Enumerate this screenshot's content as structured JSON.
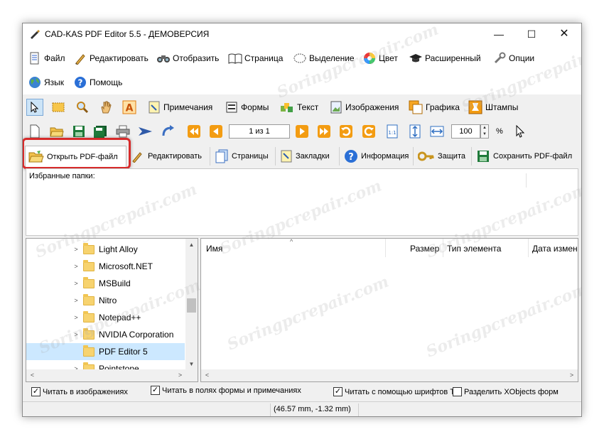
{
  "window": {
    "title": "CAD-KAS PDF Editor 5.5 - ДЕМОВЕРСИЯ",
    "controls": {
      "minimize": "—",
      "maximize": "☐",
      "close": "✕"
    }
  },
  "menu": {
    "items": [
      {
        "label": "Файл",
        "icon": "file-icon"
      },
      {
        "label": "Редактировать",
        "icon": "edit-icon"
      },
      {
        "label": "Отобразить",
        "icon": "binoculars-icon"
      },
      {
        "label": "Страница",
        "icon": "book-icon"
      },
      {
        "label": "Выделение",
        "icon": "selection-icon"
      },
      {
        "label": "Цвет",
        "icon": "color-wheel-icon"
      },
      {
        "label": "Расширенный",
        "icon": "graduation-cap-icon"
      },
      {
        "label": "Опции",
        "icon": "wrench-icon"
      },
      {
        "label": "Язык",
        "icon": "globe-icon"
      },
      {
        "label": "Помощь",
        "icon": "help-icon"
      }
    ]
  },
  "tools": {
    "labels": {
      "notes": "Примечания",
      "forms": "Формы",
      "text": "Текст",
      "images": "Изображения",
      "graphics": "Графика",
      "stamps": "Штампы"
    }
  },
  "navigation": {
    "page_display": "1 из 1",
    "zoom": "100",
    "zoom_unit": "%"
  },
  "tabs": [
    {
      "label": "Открыть PDF-файл",
      "icon": "open-folder-icon",
      "active": true
    },
    {
      "label": "Редактировать",
      "icon": "pen-icon"
    },
    {
      "label": "Страницы",
      "icon": "pages-icon"
    },
    {
      "label": "Закладки",
      "icon": "bookmark-icon"
    },
    {
      "label": "Информация",
      "icon": "info-icon"
    },
    {
      "label": "Защита",
      "icon": "key-icon"
    },
    {
      "label": "Сохранить PDF-файл",
      "icon": "save-icon"
    }
  ],
  "favorites": {
    "label": "Избранные папки:"
  },
  "tree": {
    "items": [
      {
        "label": "Light Alloy"
      },
      {
        "label": "Microsoft.NET"
      },
      {
        "label": "MSBuild"
      },
      {
        "label": "Nitro"
      },
      {
        "label": "Notepad++"
      },
      {
        "label": "NVIDIA Corporation"
      },
      {
        "label": "PDF Editor 5",
        "selected": true
      },
      {
        "label": "Pointstone"
      }
    ]
  },
  "files": {
    "columns": {
      "name": "Имя",
      "size": "Размер",
      "type": "Тип элемента",
      "date": "Дата измен"
    }
  },
  "options": {
    "read_images": {
      "label": "Читать в изображениях",
      "checked": true
    },
    "read_forms": {
      "label": "Читать в полях формы и примечаниях",
      "checked": true
    },
    "read_fonts": {
      "label": "Читать с помощью шрифтов Т",
      "checked": true
    },
    "split_xobjects": {
      "label": "Разделить XObjects форм",
      "checked": false
    }
  },
  "status": {
    "coords": "(46.57 mm, -1.32 mm)"
  },
  "watermark": "Soringpcrepair.com",
  "colors": {
    "highlight": "#d72b2b",
    "selection": "#cce8ff",
    "folder": "#f7d36f"
  }
}
